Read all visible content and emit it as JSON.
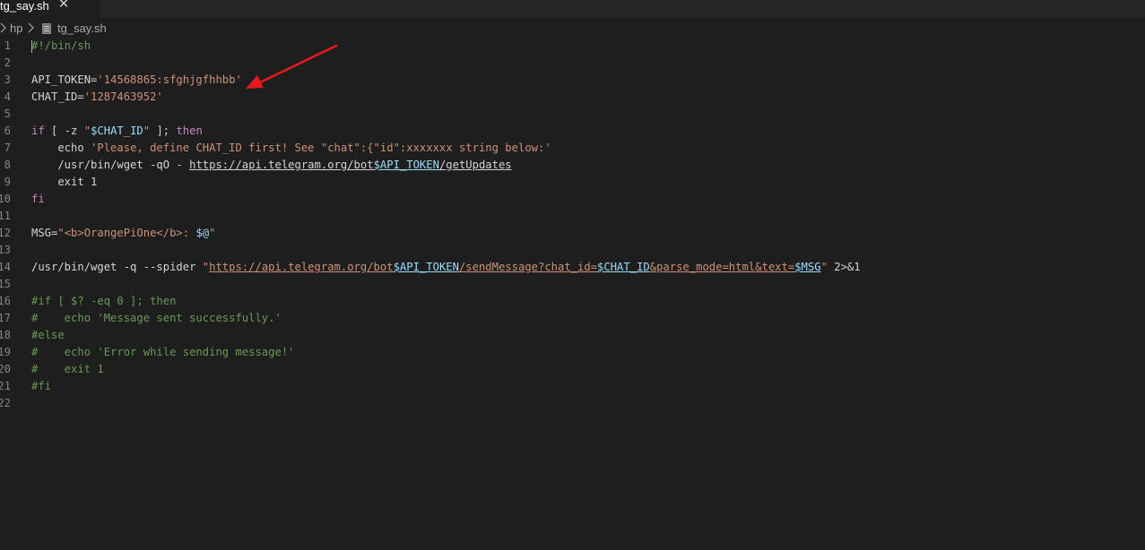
{
  "tab": {
    "filename": "tg_say.sh",
    "close_glyph": "✕"
  },
  "breadcrumb": {
    "segments": [
      "hp",
      "tg_say.sh"
    ]
  },
  "colors": {
    "background": "#1e1e1e",
    "comment": "#6a9955",
    "string": "#ce9178",
    "keyword": "#c586c0",
    "variable": "#9cdcfe",
    "plain": "#d4d4d4",
    "line_number": "#858585",
    "annotation_arrow": "#e8191a"
  },
  "icons": {
    "file": "file-icon",
    "chevron": "chevron-right-icon",
    "close": "close-icon"
  },
  "editor": {
    "lines": [
      {
        "number": "1",
        "tokens": [
          {
            "t": "#!/bin/sh",
            "k": "comment"
          }
        ]
      },
      {
        "number": "2",
        "tokens": []
      },
      {
        "number": "3",
        "tokens": [
          {
            "t": "API_TOKEN=",
            "k": "plain"
          },
          {
            "t": "'14568865:sfghjgfhhbb'",
            "k": "string"
          }
        ]
      },
      {
        "number": "4",
        "tokens": [
          {
            "t": "CHAT_ID=",
            "k": "plain"
          },
          {
            "t": "'1287463952'",
            "k": "string"
          }
        ]
      },
      {
        "number": "5",
        "tokens": []
      },
      {
        "number": "6",
        "tokens": [
          {
            "t": "if",
            "k": "keyword"
          },
          {
            "t": " [ -z ",
            "k": "plain"
          },
          {
            "t": "\"",
            "k": "string"
          },
          {
            "t": "$CHAT_ID",
            "k": "variable"
          },
          {
            "t": "\"",
            "k": "string"
          },
          {
            "t": " ]; ",
            "k": "plain"
          },
          {
            "t": "then",
            "k": "keyword"
          }
        ]
      },
      {
        "number": "7",
        "tokens": [
          {
            "t": "    echo ",
            "k": "plain"
          },
          {
            "t": "'Please, define CHAT_ID first! See \"chat\":{\"id\":xxxxxxx string below:'",
            "k": "string"
          }
        ]
      },
      {
        "number": "8",
        "tokens": [
          {
            "t": "    /usr/bin/wget -qO - ",
            "k": "plain"
          },
          {
            "t": "https://api.telegram.org/bot",
            "k": "plain",
            "link": true
          },
          {
            "t": "$API_TOKEN",
            "k": "variable",
            "link": true
          },
          {
            "t": "/getUpdates",
            "k": "plain",
            "link": true
          }
        ]
      },
      {
        "number": "9",
        "tokens": [
          {
            "t": "    exit 1",
            "k": "plain"
          }
        ]
      },
      {
        "number": "10",
        "tokens": [
          {
            "t": "fi",
            "k": "keyword"
          }
        ]
      },
      {
        "number": "11",
        "tokens": []
      },
      {
        "number": "12",
        "tokens": [
          {
            "t": "MSG=",
            "k": "plain"
          },
          {
            "t": "\"<b>OrangePiOne</b>: ",
            "k": "string"
          },
          {
            "t": "$@",
            "k": "variable"
          },
          {
            "t": "\"",
            "k": "string"
          }
        ]
      },
      {
        "number": "13",
        "tokens": []
      },
      {
        "number": "14",
        "tokens": [
          {
            "t": "/usr/bin/wget -q --spider ",
            "k": "plain"
          },
          {
            "t": "\"",
            "k": "string"
          },
          {
            "t": "https://api.telegram.org/bot",
            "k": "string",
            "link": true
          },
          {
            "t": "$API_TOKEN",
            "k": "variable",
            "link": true
          },
          {
            "t": "/sendMessage?chat_id=",
            "k": "string",
            "link": true
          },
          {
            "t": "$CHAT_ID",
            "k": "variable",
            "link": true
          },
          {
            "t": "&parse_mode=html&text=",
            "k": "string",
            "link": true
          },
          {
            "t": "$MSG",
            "k": "variable",
            "link": true
          },
          {
            "t": "\"",
            "k": "string"
          },
          {
            "t": " 2>&1",
            "k": "plain"
          }
        ]
      },
      {
        "number": "15",
        "tokens": []
      },
      {
        "number": "16",
        "tokens": [
          {
            "t": "#if [ $? -eq 0 ]; then",
            "k": "comment"
          }
        ]
      },
      {
        "number": "17",
        "tokens": [
          {
            "t": "#    echo 'Message sent successfully.'",
            "k": "comment"
          }
        ]
      },
      {
        "number": "18",
        "tokens": [
          {
            "t": "#else",
            "k": "comment"
          }
        ]
      },
      {
        "number": "19",
        "tokens": [
          {
            "t": "#    echo 'Error while sending message!'",
            "k": "comment"
          }
        ]
      },
      {
        "number": "20",
        "tokens": [
          {
            "t": "#    exit 1",
            "k": "comment"
          }
        ]
      },
      {
        "number": "21",
        "tokens": [
          {
            "t": "#fi",
            "k": "comment"
          }
        ]
      },
      {
        "number": "22",
        "tokens": []
      }
    ]
  }
}
